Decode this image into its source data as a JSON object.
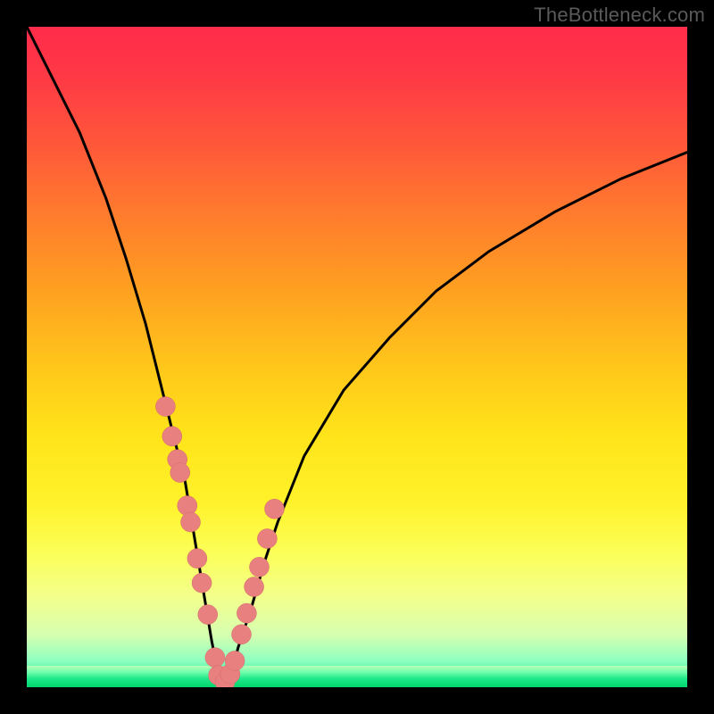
{
  "watermark": "TheBottleneck.com",
  "chart_data": {
    "type": "line",
    "title": "",
    "xlabel": "",
    "ylabel": "",
    "xlim": [
      0,
      100
    ],
    "ylim": [
      0,
      100
    ],
    "series": [
      {
        "name": "bottleneck-curve",
        "x": [
          0,
          4,
          8,
          12,
          15,
          18,
          20,
          22,
          24,
          25,
          26,
          27,
          28,
          29,
          30,
          31,
          32,
          34,
          36,
          38,
          42,
          48,
          55,
          62,
          70,
          80,
          90,
          100
        ],
        "y": [
          100,
          92,
          84,
          74,
          65,
          55,
          47,
          39,
          31,
          25,
          19,
          13,
          7,
          2,
          0,
          2,
          6,
          12,
          19,
          25,
          35,
          45,
          53,
          60,
          66,
          72,
          77,
          81
        ]
      }
    ],
    "markers": {
      "name": "sample-points",
      "x": [
        21.0,
        22.0,
        22.8,
        23.2,
        24.3,
        24.8,
        25.8,
        26.5,
        27.4,
        28.5,
        29.0,
        30.0,
        30.8,
        31.5,
        32.5,
        33.3,
        34.4,
        35.2,
        36.4,
        37.5
      ],
      "y": [
        42.5,
        38.0,
        34.5,
        32.5,
        27.5,
        25.0,
        19.5,
        15.8,
        11.0,
        4.5,
        1.8,
        0.8,
        2.0,
        4.0,
        8.0,
        11.2,
        15.2,
        18.2,
        22.5,
        27.0
      ]
    },
    "gradient_colors": {
      "top": "#ff2b4a",
      "mid": "#ffe41a",
      "bottom": "#00d66f"
    }
  }
}
